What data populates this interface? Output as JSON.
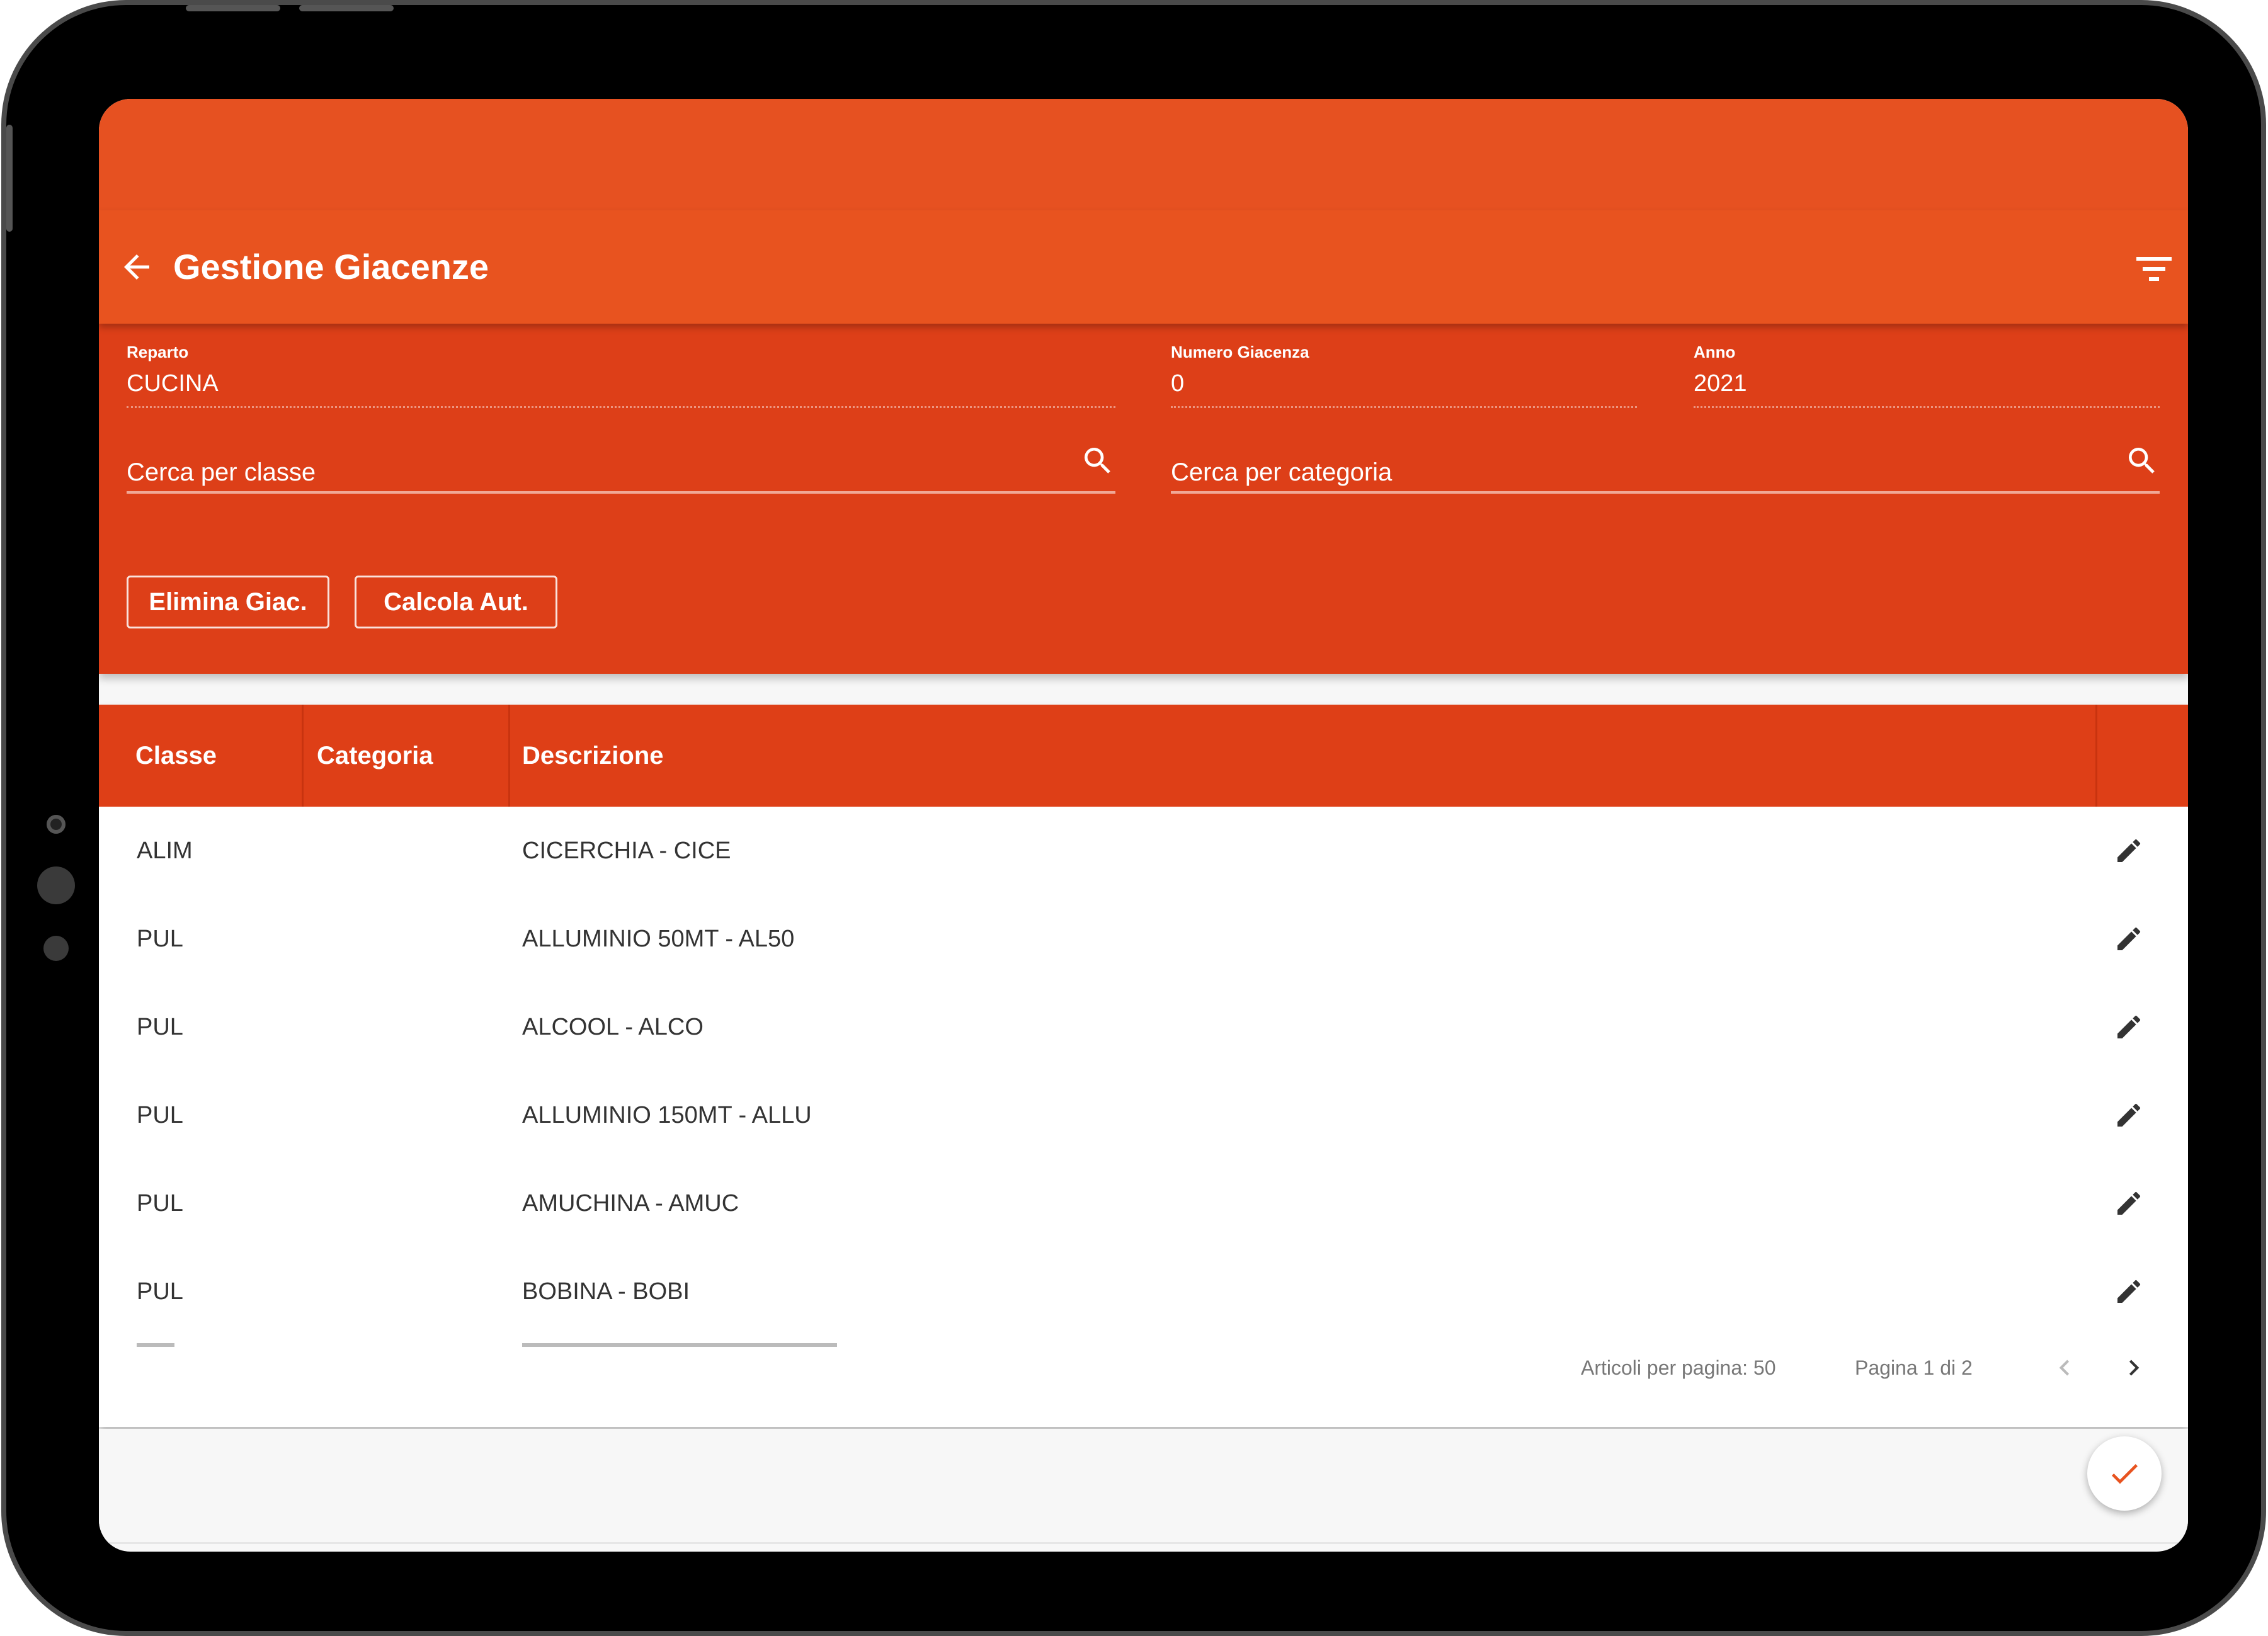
{
  "app": {
    "title": "Gestione Giacenze",
    "accent_color": "#e8531f",
    "back_icon": "arrow-left-icon",
    "filter_icon": "filter-icon"
  },
  "form": {
    "reparto": {
      "label": "Reparto",
      "value": "CUCINA"
    },
    "numero_giacenza": {
      "label": "Numero Giacenza",
      "value": "0"
    },
    "anno": {
      "label": "Anno",
      "value": "2021"
    },
    "search_classe": {
      "placeholder": "Cerca per classe",
      "icon": "search-icon"
    },
    "search_categoria": {
      "placeholder": "Cerca per categoria",
      "icon": "search-icon"
    },
    "buttons": {
      "elimina": "Elimina Giac.",
      "calcola": "Calcola Aut."
    }
  },
  "table": {
    "headers": [
      "Classe",
      "Categoria",
      "Descrizione"
    ],
    "rows": [
      {
        "classe": "ALIM",
        "categoria": "",
        "descrizione": "CICERCHIA - CICE"
      },
      {
        "classe": "PUL",
        "categoria": "",
        "descrizione": "ALLUMINIO 50MT - AL50"
      },
      {
        "classe": "PUL",
        "categoria": "",
        "descrizione": "ALCOOL - ALCO"
      },
      {
        "classe": "PUL",
        "categoria": "",
        "descrizione": "ALLUMINIO 150MT - ALLU"
      },
      {
        "classe": "PUL",
        "categoria": "",
        "descrizione": "AMUCHINA - AMUC"
      },
      {
        "classe": "PUL",
        "categoria": "",
        "descrizione": "BOBINA - BOBI"
      }
    ],
    "row_action_icon": "pencil-icon"
  },
  "paginator": {
    "items_per_page": "Articoli per pagina: 50",
    "page_label": "Pagina 1 di 2"
  },
  "fab": {
    "icon": "check-icon"
  }
}
